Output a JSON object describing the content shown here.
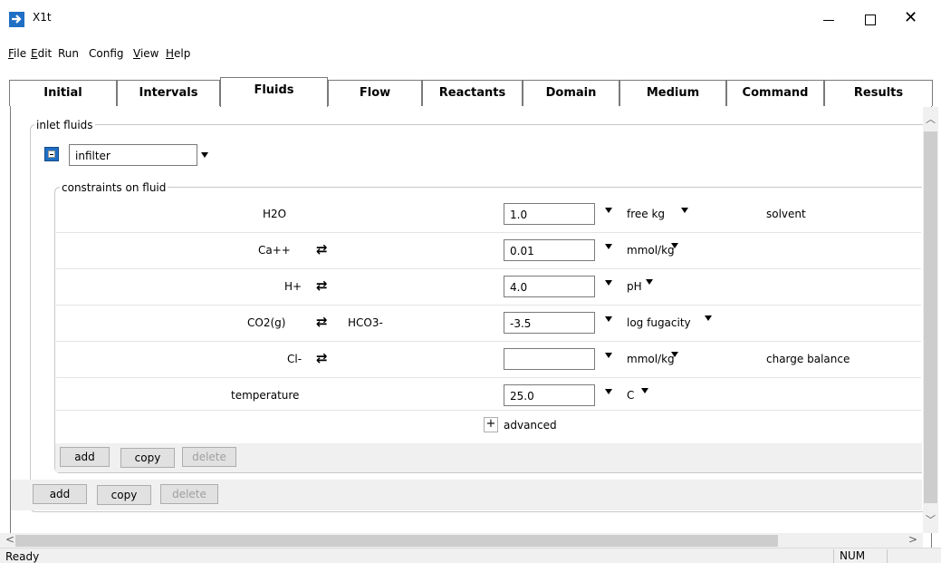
{
  "window": {
    "title": "X1t"
  },
  "menu": {
    "file": "F",
    "file_rest": "ile",
    "edit": "E",
    "edit_rest": "dit",
    "run": "Run",
    "config": "Config",
    "view": "V",
    "view_rest": "iew",
    "help": "H",
    "help_rest": "elp"
  },
  "tabs": [
    "Initial",
    "Intervals",
    "Fluids",
    "Flow",
    "Reactants",
    "Domain",
    "Medium",
    "Command",
    "Results"
  ],
  "active_tab": "Fluids",
  "inlet": {
    "group_label": "inlet fluids",
    "fluid_name": "infilter",
    "constraints_label": "constraints on fluid",
    "rows": [
      {
        "species": "H2O",
        "swap_with": "",
        "value": "1.0",
        "unit": "free kg",
        "note": "solvent"
      },
      {
        "species": "Ca++",
        "swap_with": "",
        "value": "0.01",
        "unit": "mmol/kg",
        "note": ""
      },
      {
        "species": "H+",
        "swap_with": "",
        "value": "4.0",
        "unit": "pH",
        "note": ""
      },
      {
        "species": "CO2(g)",
        "swap_with": "HCO3-",
        "value": "-3.5",
        "unit": "log fugacity",
        "note": ""
      },
      {
        "species": "Cl-",
        "swap_with": "",
        "value": "",
        "unit": "mmol/kg",
        "note": "charge balance"
      },
      {
        "species": "temperature",
        "swap_with": "",
        "value": "25.0",
        "unit": "C",
        "note": ""
      }
    ],
    "advanced_label": "advanced",
    "advanced_symbol": "+"
  },
  "buttons": {
    "add": "add",
    "copy": "copy",
    "delete": "delete"
  },
  "status": {
    "text": "Ready",
    "num": "NUM"
  },
  "icons": {
    "swap": "⇄",
    "dropdown": "chevron-down-icon",
    "collapse": "collapse-icon"
  },
  "colors": {
    "accent": "#1f6fc4",
    "panel_bg": "#f0f0f0"
  }
}
